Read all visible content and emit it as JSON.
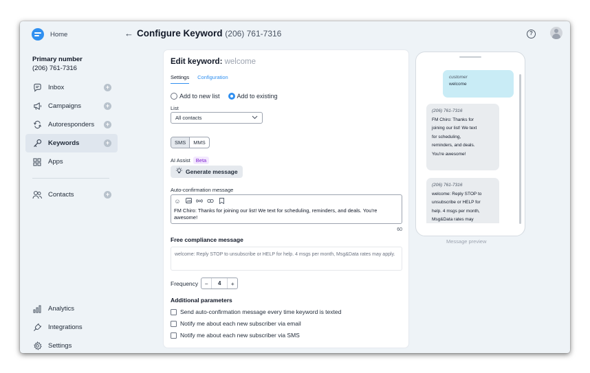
{
  "sidebar": {
    "home_label": "Home",
    "primary_label": "Primary number",
    "primary_value": "(206) 761-7316",
    "items": [
      {
        "label": "Inbox",
        "icon": "chat-bubble-icon"
      },
      {
        "label": "Campaigns",
        "icon": "megaphone-icon"
      },
      {
        "label": "Autoresponders",
        "icon": "repeat-icon"
      },
      {
        "label": "Keywords",
        "icon": "key-icon",
        "active": true
      },
      {
        "label": "Apps",
        "icon": "grid-icon"
      }
    ],
    "contacts_label": "Contacts",
    "bottom": {
      "analytics": "Analytics",
      "integrations": "Integrations",
      "settings": "Settings"
    }
  },
  "header": {
    "title": "Configure Keyword",
    "subtitle": "(206) 761-7316"
  },
  "editor": {
    "title": "Edit keyword:",
    "keyword": "welcome",
    "tabs": [
      "Settings",
      "Configuration"
    ],
    "radio_add_new": "Add to new list",
    "radio_add_existing": "Add to existing",
    "list_label": "List",
    "list_value": "All contacts",
    "seg_sms": "SMS",
    "seg_mms": "MMS",
    "ai_assist_label": "AI Assist",
    "beta_badge": "Beta",
    "generate_label": "Generate message",
    "auto_conf_label": "Auto-confirmation message",
    "auto_conf_text": "FM Chiro: Thanks for joining our list! We text for scheduling, reminders, and deals. You're awesome!",
    "char_count": "60",
    "compliance_title": "Free compliance message",
    "compliance_text": "welcome: Reply STOP to unsubscribe or HELP for help. 4 msgs per month, Msg&Data rates may apply.",
    "frequency_label": "Frequency",
    "frequency_minus": "−",
    "frequency_value": "4",
    "frequency_plus": "+",
    "additional_title": "Additional parameters",
    "checks": [
      "Send auto-confirmation message every time keyword is texted",
      "Notify me about each new subscriber via email",
      "Notify me about each new subscriber via SMS"
    ]
  },
  "preview": {
    "customer_label": "customer",
    "customer_text": "welcome",
    "reply1_from": "(206) 761-7316",
    "reply1_lines": [
      "FM Chiro: Thanks for",
      "joining our list! We text",
      "for scheduling,",
      "reminders, and deals.",
      "You're awesome!"
    ],
    "reply2_from": "(206) 761-7316",
    "reply2_lines": [
      "welcome: Reply STOP to",
      "unsubscribe or HELP for",
      "help. 4 msgs per month,",
      "Msg&Data rates may"
    ],
    "caption": "Message preview"
  },
  "colors": {
    "accent": "#2f8ff0",
    "background": "#eef3f7",
    "bubble_out": "#c9ecf6",
    "bubble_in": "#e9ecef"
  }
}
